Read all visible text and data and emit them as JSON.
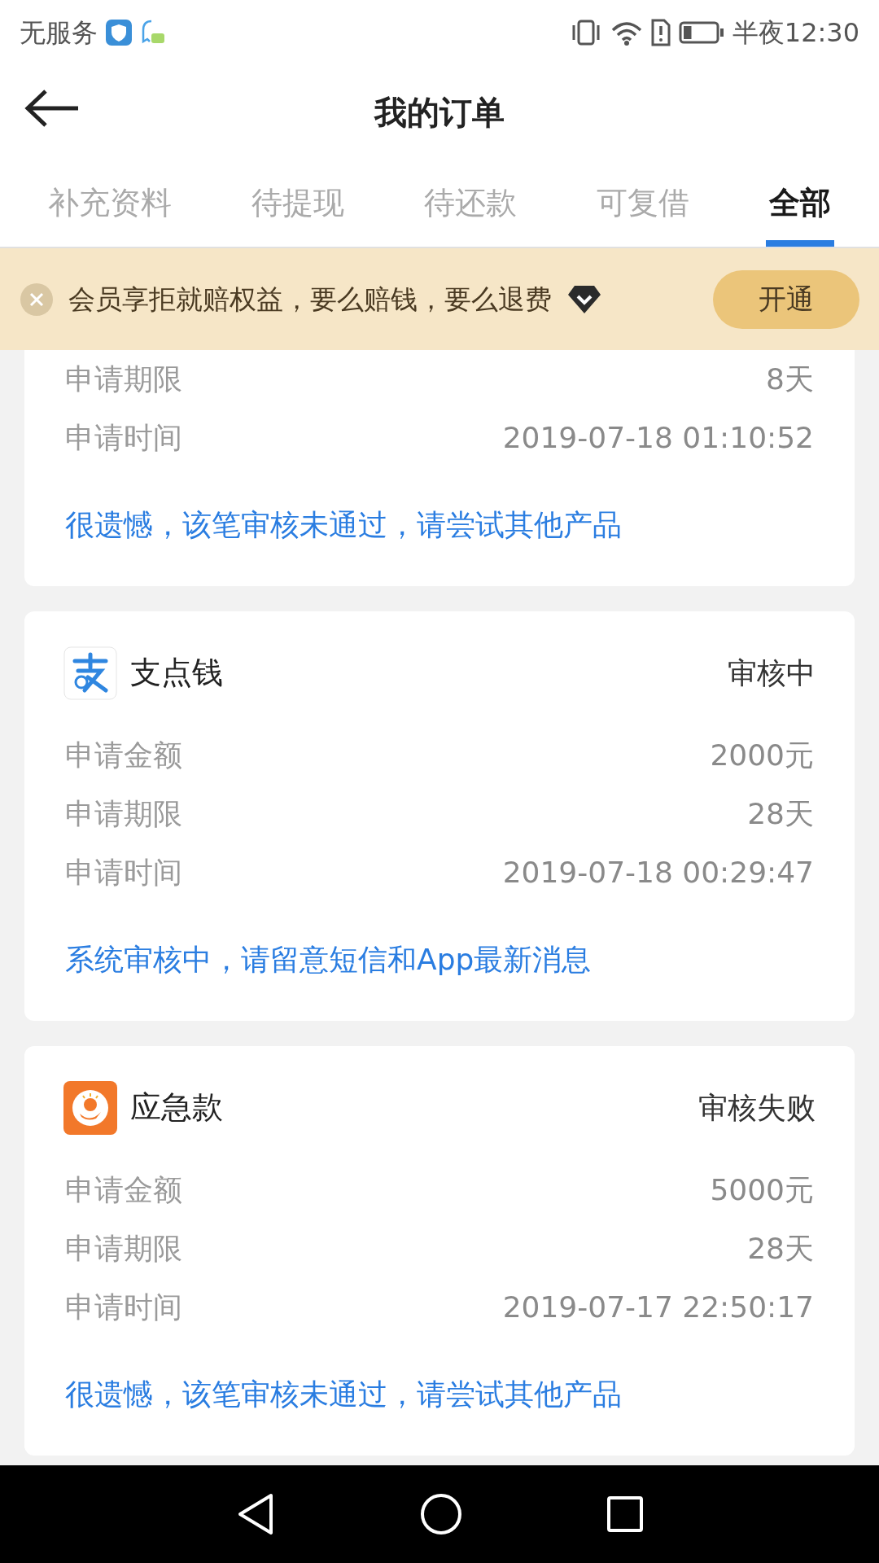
{
  "status_bar": {
    "carrier": "无服务",
    "time": "半夜12:30"
  },
  "header": {
    "title": "我的订单"
  },
  "tabs": [
    {
      "label": "补充资料",
      "selected": false
    },
    {
      "label": "待提现",
      "selected": false
    },
    {
      "label": "待还款",
      "selected": false
    },
    {
      "label": "可复借",
      "selected": false
    },
    {
      "label": "全部",
      "selected": true
    }
  ],
  "banner": {
    "text": "会员享拒就赔权益，要么赔钱，要么退费",
    "button": "开通"
  },
  "orders": [
    {
      "rows": [
        {
          "label": "申请期限",
          "value": "8天"
        },
        {
          "label": "申请时间",
          "value": "2019-07-18 01:10:52"
        }
      ],
      "message": "很遗憾，该笔审核未通过，请尝试其他产品"
    },
    {
      "kind": "zhi",
      "name": "支点钱",
      "status": "审核中",
      "rows": [
        {
          "label": "申请金额",
          "value": "2000元"
        },
        {
          "label": "申请期限",
          "value": "28天"
        },
        {
          "label": "申请时间",
          "value": "2019-07-18 00:29:47"
        }
      ],
      "message": "系统审核中，请留意短信和App最新消息"
    },
    {
      "kind": "coin",
      "name": "应急款",
      "status": "审核失败",
      "rows": [
        {
          "label": "申请金额",
          "value": "5000元"
        },
        {
          "label": "申请期限",
          "value": "28天"
        },
        {
          "label": "申请时间",
          "value": "2019-07-17 22:50:17"
        }
      ],
      "message": "很遗憾，该笔审核未通过，请尝试其他产品"
    }
  ]
}
